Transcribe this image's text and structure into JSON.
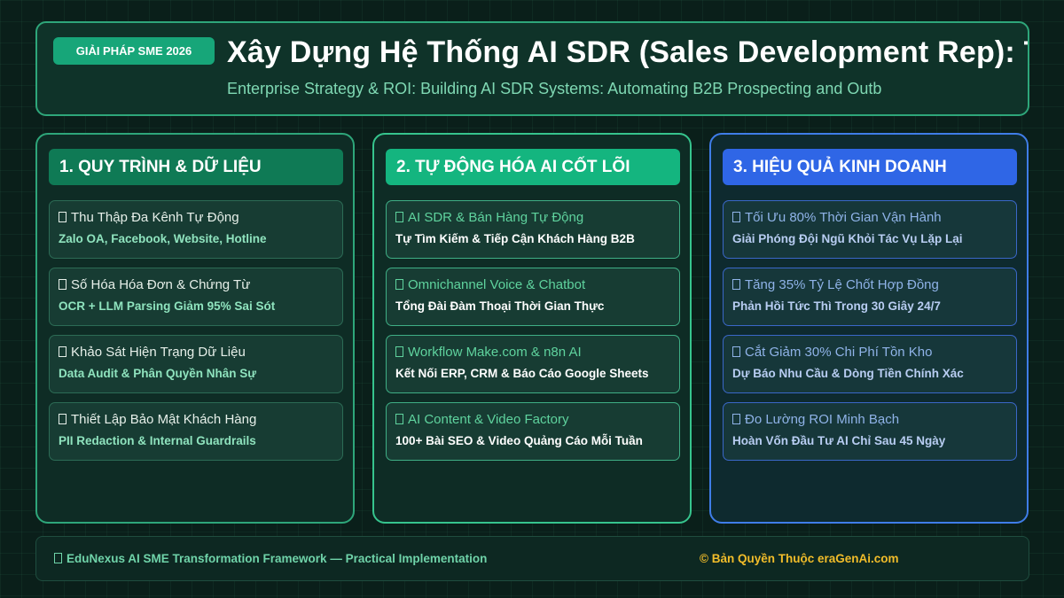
{
  "header": {
    "badge": "GIẢI PHÁP SME 2026",
    "title": "Xây Dựng Hệ Thống AI SDR (Sales Development Rep): Tự",
    "subtitle": "Enterprise Strategy & ROI: Building AI SDR Systems: Automating B2B Prospecting and Outb"
  },
  "columns": [
    {
      "heading": "1. QUY TRÌNH & DỮ LIỆU",
      "cards": [
        {
          "title": "Thu Thập Đa Kênh Tự Động",
          "desc": "Zalo OA, Facebook, Website, Hotline"
        },
        {
          "title": "Số Hóa Hóa Đơn & Chứng Từ",
          "desc": "OCR + LLM Parsing Giảm 95% Sai Sót"
        },
        {
          "title": "Khảo Sát Hiện Trạng Dữ Liệu",
          "desc": "Data Audit & Phân Quyền Nhân Sự"
        },
        {
          "title": "Thiết Lập Bảo Mật Khách Hàng",
          "desc": "PII Redaction & Internal Guardrails"
        }
      ]
    },
    {
      "heading": "2. TỰ ĐỘNG HÓA AI CỐT LÕI",
      "cards": [
        {
          "title": "AI SDR & Bán Hàng Tự Động",
          "desc": "Tự Tìm Kiếm & Tiếp Cận Khách Hàng B2B"
        },
        {
          "title": "Omnichannel Voice & Chatbot",
          "desc": "Tổng Đài Đàm Thoại Thời Gian Thực"
        },
        {
          "title": "Workflow Make.com & n8n AI",
          "desc": "Kết Nối ERP, CRM & Báo Cáo Google Sheets"
        },
        {
          "title": "AI Content & Video Factory",
          "desc": "100+ Bài SEO & Video Quảng Cáo Mỗi Tuần"
        }
      ]
    },
    {
      "heading": "3. HIỆU QUẢ KINH DOANH",
      "cards": [
        {
          "title": "Tối Ưu 80% Thời Gian Vận Hành",
          "desc": "Giải Phóng Đội Ngũ Khỏi Tác Vụ Lặp Lại"
        },
        {
          "title": "Tăng 35% Tỷ Lệ Chốt Hợp Đồng",
          "desc": "Phản Hồi Tức Thì Trong 30 Giây 24/7"
        },
        {
          "title": "Cắt Giảm 30% Chi Phí Tồn Kho",
          "desc": "Dự Báo Nhu Cầu & Dòng Tiền Chính Xác"
        },
        {
          "title": "Đo Lường ROI Minh Bạch",
          "desc": "Hoàn Vốn Đầu Tư AI Chỉ Sau 45 Ngày"
        }
      ]
    }
  ],
  "footer": {
    "left": "EduNexus AI SME Transformation Framework — Practical Implementation",
    "right": "© Bản Quyền Thuộc eraGenAi.com"
  },
  "icons": {
    "card_icon": "missing-glyph-icon"
  },
  "colors": {
    "accent_green": "#17a679",
    "accent_blue": "#2f66e6",
    "footer_gold": "#f2bd2a"
  }
}
